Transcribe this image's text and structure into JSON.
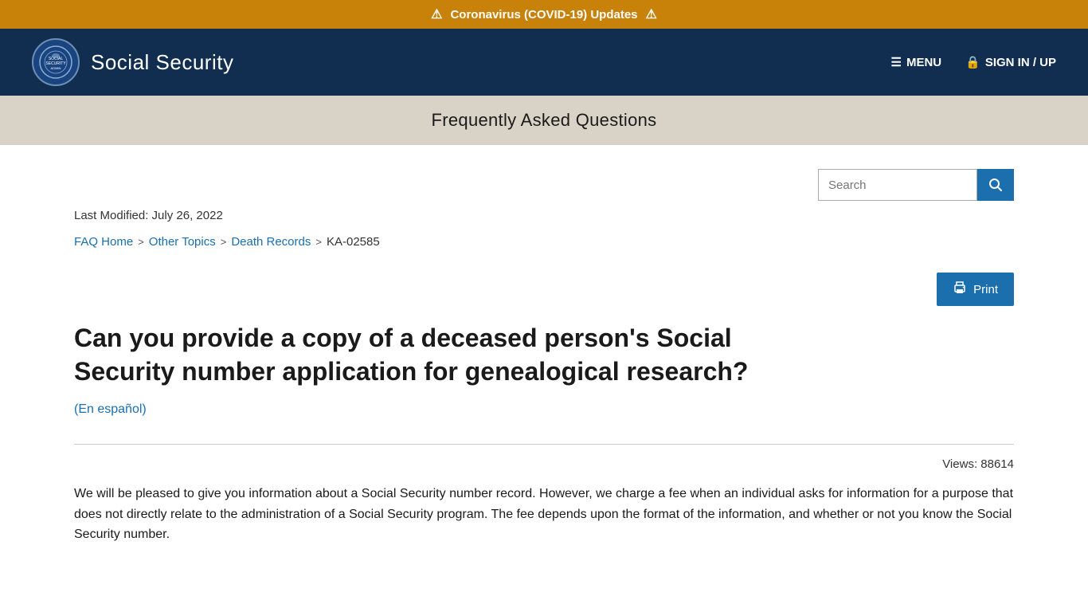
{
  "alert": {
    "icon_left": "⚠",
    "icon_right": "⚠",
    "text": "Coronavirus (COVID-19) Updates"
  },
  "header": {
    "logo_alt": "Social Security Administration seal",
    "site_title": "Social Security",
    "menu_label": "MENU",
    "signin_label": "SIGN IN / UP"
  },
  "subtitle_bar": {
    "heading": "Frequently Asked Questions"
  },
  "search": {
    "placeholder": "Search",
    "button_icon": "🔍"
  },
  "last_modified": {
    "label": "Last Modified: July 26, 2022"
  },
  "breadcrumb": {
    "items": [
      {
        "label": "FAQ Home",
        "href": "#",
        "type": "link"
      },
      {
        "sep": ">"
      },
      {
        "label": "Other Topics",
        "href": "#",
        "type": "link"
      },
      {
        "sep": ">"
      },
      {
        "label": "Death Records",
        "href": "#",
        "type": "link"
      },
      {
        "sep": ">"
      },
      {
        "label": "KA-02585",
        "type": "current"
      }
    ]
  },
  "print_button": {
    "label": "Print"
  },
  "article": {
    "title": "Can you provide a copy of a deceased person's Social Security number application for genealogical research?",
    "spanish_link": "(En español)",
    "views": "Views: 88614",
    "body": "We will be pleased to give you information about a Social Security number record. However, we charge a fee when an individual asks for information for a purpose that does not directly relate to the administration of a Social Security program. The fee depends upon the format of the information, and whether or not you know the Social Security number."
  }
}
